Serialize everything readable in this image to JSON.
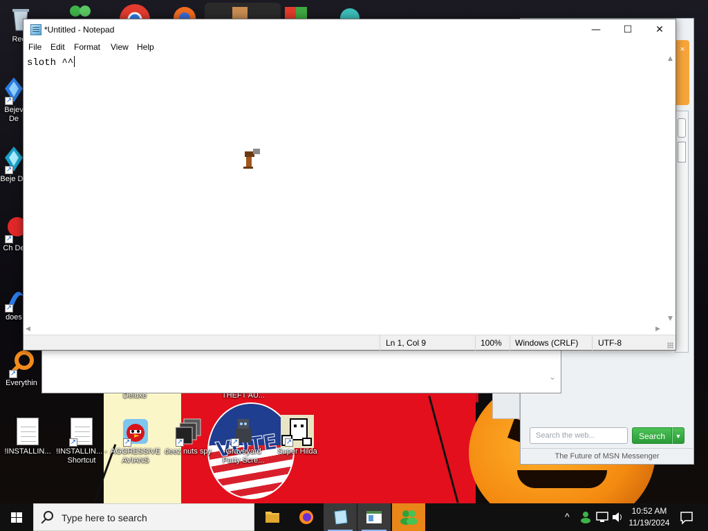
{
  "desktop": {
    "icons": [
      {
        "label": "Recy",
        "name": "recycle-bin"
      },
      {
        "label": "Bejev De",
        "name": "bejeweled-deluxe-1"
      },
      {
        "label": "Beje De",
        "name": "bejeweled-deluxe-2"
      },
      {
        "label": "Ch De",
        "name": "chuzzle-deluxe"
      },
      {
        "label": "does",
        "name": "does"
      },
      {
        "label": "Everythin",
        "name": "everything"
      },
      {
        "label": "Deluxe",
        "name": "deluxe"
      },
      {
        "label": "THEFT AU...",
        "name": "theft-auto"
      },
      {
        "label": "!INSTALLIN...",
        "name": "installing-1"
      },
      {
        "label": "!INSTALLIN... - Shortcut",
        "name": "installing-shortcut"
      },
      {
        "label": "AGGRESSIVE AVIANS",
        "name": "aggressive-avians"
      },
      {
        "label": "deez nuts spy",
        "name": "deez-nuts-spy"
      },
      {
        "label": "Graveyard Party Scre...",
        "name": "graveyard-party"
      },
      {
        "label": "Super Hilda",
        "name": "super-hilda"
      }
    ],
    "wallpaper_badge_text": "VOTE"
  },
  "msn": {
    "search_placeholder": "Search the web...",
    "search_button": "Search",
    "footer": "The Future of MSN Messenger",
    "close_glyph": "×"
  },
  "notepad": {
    "title": "*Untitled - Notepad",
    "controls": {
      "minimize": "—",
      "maximize": "☐",
      "close": "✕"
    },
    "menu": [
      "File",
      "Edit",
      "Format",
      "View",
      "Help"
    ],
    "content": "sloth ^^",
    "status": {
      "position": "Ln 1, Col 9",
      "zoom": "100%",
      "line_ending": "Windows (CRLF)",
      "encoding": "UTF-8"
    }
  },
  "taskbar": {
    "search_placeholder": "Type here to search",
    "apps": [
      "file-explorer",
      "firefox",
      "notepad",
      "store-app",
      "msn-messenger"
    ],
    "tray": {
      "chevron": "^"
    },
    "clock": {
      "time": "10:52 AM",
      "date": "11/19/2024"
    }
  },
  "colors": {
    "taskbar": "#101010",
    "msn_green": "#2a9a36",
    "wallpaper_red": "#e30f1c",
    "pumpkin": "#f48a10"
  }
}
